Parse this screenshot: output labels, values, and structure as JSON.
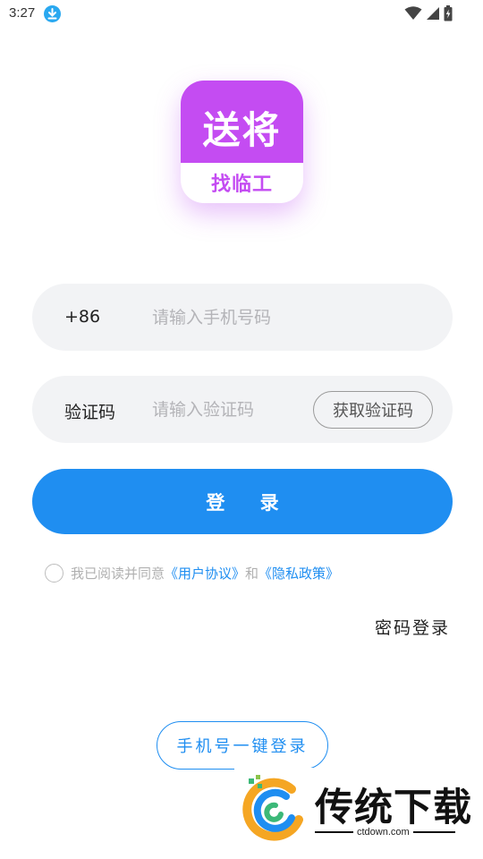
{
  "status_bar": {
    "time": "3:27",
    "icons": [
      "download-notification-icon",
      "wifi-icon",
      "signal-icon",
      "battery-charging-icon"
    ]
  },
  "logo": {
    "main_text": "送将",
    "sub_text": "找临工",
    "color": "#c44cf2"
  },
  "phone_field": {
    "prefix": "+86",
    "placeholder": "请输入手机号码",
    "value": ""
  },
  "code_field": {
    "label": "验证码",
    "placeholder": "请输入验证码",
    "value": "",
    "get_code_label": "获取验证码"
  },
  "login_button": {
    "label": "登 录",
    "color": "#1f8ef1"
  },
  "agreement": {
    "checked": false,
    "prefix": "我已阅读并同意",
    "user_agreement": "《用户协议》",
    "and": "和",
    "privacy_policy": "《隐私政策》"
  },
  "password_login_label": "密码登录",
  "one_click_login_label": "手机号一键登录",
  "watermark": {
    "title": "传统下载",
    "url": "ctdown.com"
  }
}
